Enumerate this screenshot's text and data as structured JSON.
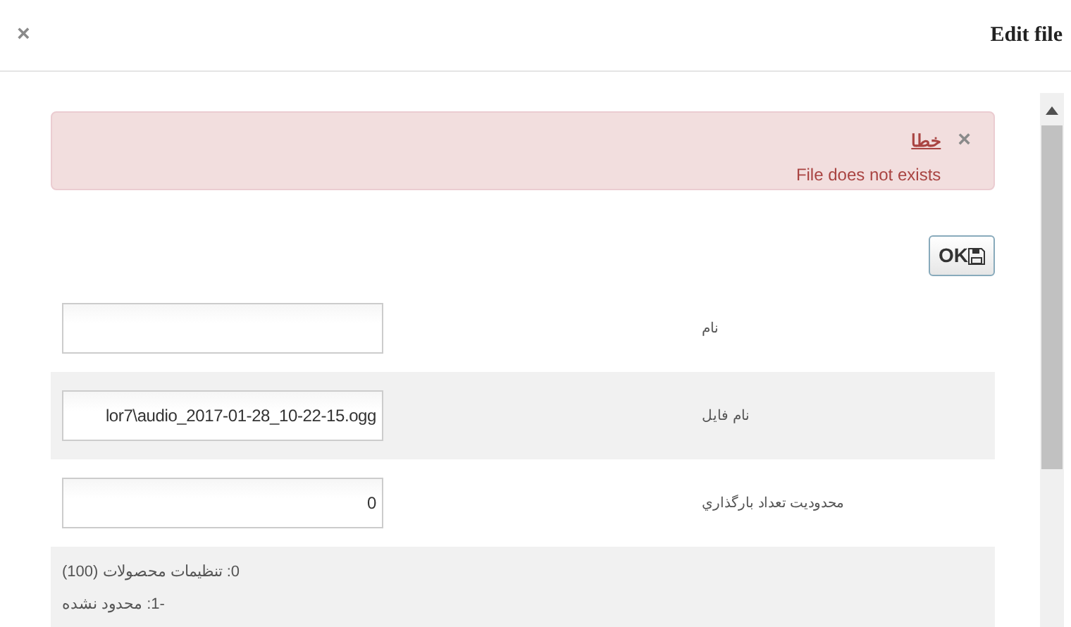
{
  "dialog": {
    "title": "Edit file",
    "close": "×"
  },
  "alert": {
    "close": "×",
    "title": "خطا",
    "message": "File does not exists"
  },
  "ok_button": {
    "label": "OK"
  },
  "fields": [
    {
      "label": "نام"
    },
    {
      "label": "نام فایل",
      "value": "lor7\\audio_2017-01-28_10-22-15.ogg"
    },
    {
      "label": "محدودیت تعداد بارگذاري",
      "value": "0"
    }
  ],
  "notes": [
    "0: تنظیمات محصولات (100)",
    "-1: محدود نشده"
  ]
}
